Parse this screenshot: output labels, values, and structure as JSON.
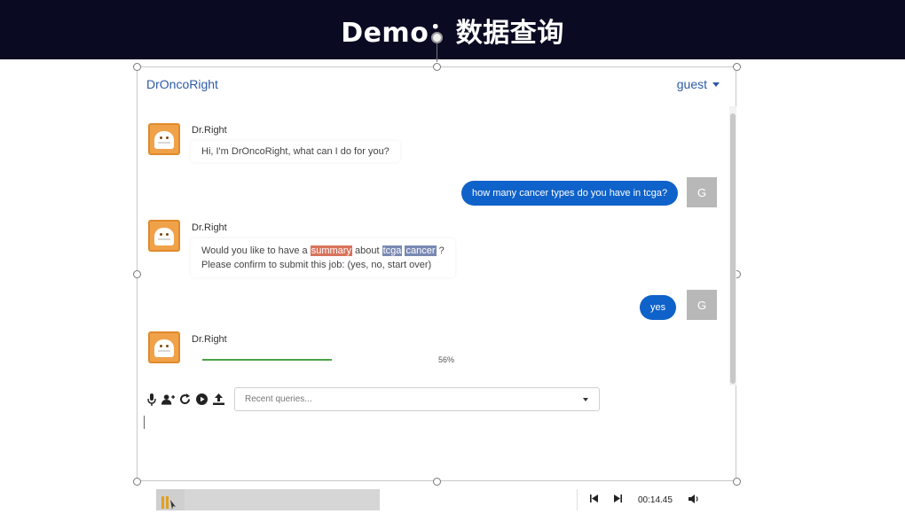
{
  "banner": {
    "title": "Demo：数据查询"
  },
  "app": {
    "brand": "DrOncoRight",
    "user": "guest"
  },
  "conversation": {
    "bot_name": "Dr.Right",
    "greeting": "Hi, I'm DrOncoRight, what can I do for you?",
    "user_question": "how many cancer types do you have in tcga?",
    "confirm_prefix": "Would you like to have a",
    "confirm_word1": "summary",
    "confirm_mid": "about",
    "confirm_word2": "tcga",
    "confirm_word3": "cancer",
    "confirm_suffix": "?",
    "confirm_line2": "Please confirm to submit this job: (yes, no, start over)",
    "user_reply": "yes",
    "user_avatar_letter": "G",
    "progress_text": "56%",
    "progress_fraction": 0.56
  },
  "input": {
    "recent_queries_placeholder": "Recent queries..."
  },
  "media": {
    "time": "00:14.45"
  },
  "colors": {
    "banner": "#0a0a23",
    "brand": "#2d5aa6",
    "user_bubble": "#0f62c9",
    "bot_avatar": "#f0a24a",
    "progress": "#4aa34a"
  },
  "icons": [
    "microphone-icon",
    "add-user-icon",
    "refresh-icon",
    "play-circle-icon",
    "upload-icon",
    "pause-icon",
    "skip-back-icon",
    "skip-forward-icon",
    "volume-icon"
  ]
}
